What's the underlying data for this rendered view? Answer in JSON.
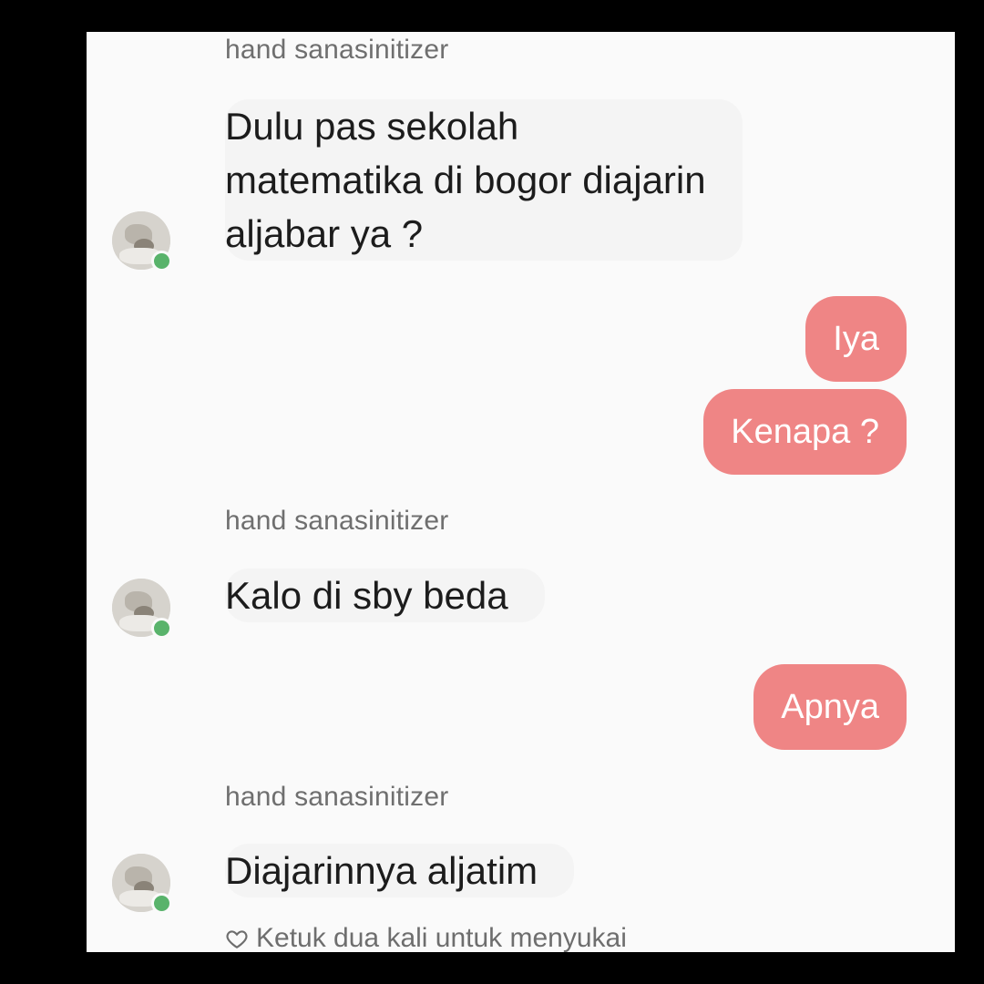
{
  "conversation": {
    "messages": [
      {
        "sender": "hand sanasinitizer",
        "text": "Dulu pas sekolah\nmatematika di bogor diajarin\naljabar ya ?"
      },
      {
        "outgoing": [
          "Iya",
          "Kenapa ?"
        ]
      },
      {
        "sender": "hand sanasinitizer",
        "text": "Kalo di sby beda"
      },
      {
        "outgoing": [
          "Apnya"
        ]
      },
      {
        "sender": "hand sanasinitizer",
        "text": "Diajarinnya aljatim"
      }
    ],
    "like_hint": "Ketuk dua kali untuk menyukai"
  },
  "colors": {
    "outgoing_bubble": "#ef8585",
    "online_dot": "#59b36b"
  },
  "icons": {
    "avatar": "user-avatar",
    "online": "online-status-dot",
    "like": "heart-outline-icon"
  }
}
